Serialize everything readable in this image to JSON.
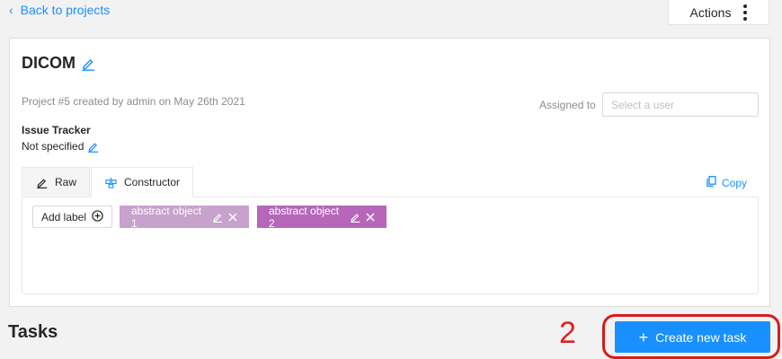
{
  "nav": {
    "back_label": "Back to projects",
    "actions_label": "Actions"
  },
  "project": {
    "title": "DICOM",
    "meta": "Project #5 created by admin on May 26th 2021",
    "assigned_label": "Assigned to",
    "assigned_placeholder": "Select a user",
    "issue_tracker_heading": "Issue Tracker",
    "issue_tracker_value": "Not specified"
  },
  "tabs": [
    {
      "label": "Raw",
      "icon": "pencil-icon"
    },
    {
      "label": "Constructor",
      "icon": "build-icon",
      "active": true
    }
  ],
  "copy_label": "Copy",
  "labels": {
    "add_label": "Add label",
    "items": [
      {
        "name": "abstract object 1",
        "color": "#c7a2cc"
      },
      {
        "name": "abstract object 2",
        "color": "#b667ba"
      }
    ]
  },
  "tasks": {
    "heading": "Tasks",
    "create_label": "Create new task"
  },
  "annotation": {
    "number": "2",
    "color": "#e02020"
  },
  "colors": {
    "accent": "#1890ff"
  }
}
